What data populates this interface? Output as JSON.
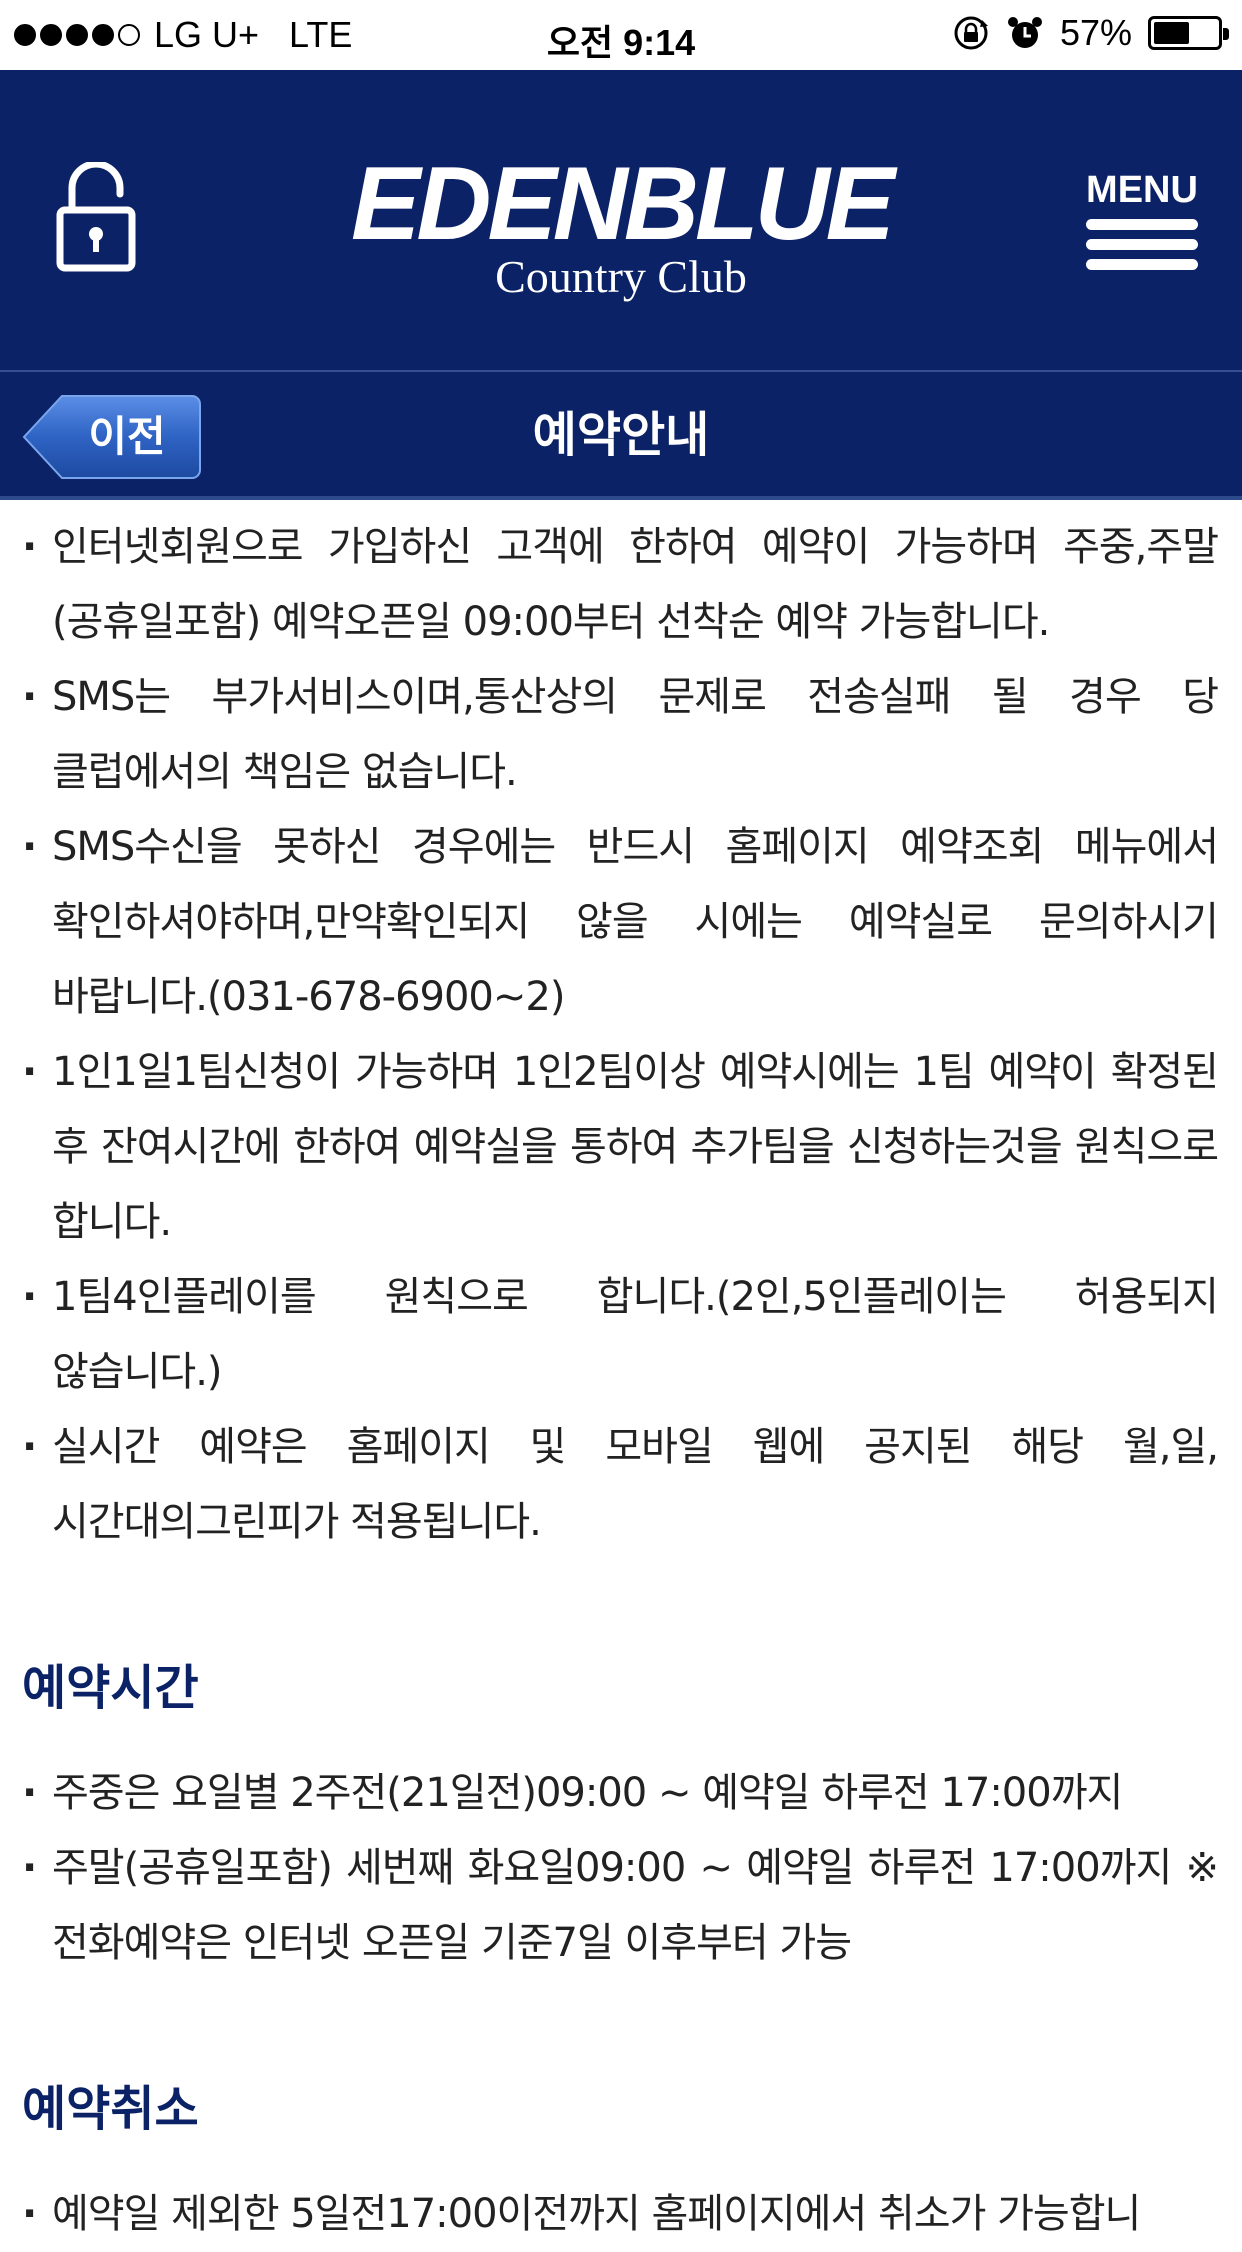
{
  "status_bar": {
    "carrier": "LG U+",
    "network": "LTE",
    "time": "오전 9:14",
    "battery_percent": "57%",
    "battery_level": 0.57,
    "signal_bars": [
      true,
      true,
      true,
      true,
      false
    ]
  },
  "header": {
    "brand_title": "EDENBLUE",
    "brand_subtitle": "Country Club",
    "menu_label": "MENU",
    "lock_icon": "lock-open-icon"
  },
  "title_bar": {
    "back_label": "이전",
    "page_title": "예약안내"
  },
  "intro_items": [
    "인터넷회원으로 가입하신 고객에 한하여 예약이 가능하며 주중,주말(공휴일포함) 예약오픈일 09:00부터 선착순 예약 가능합니다.",
    "SMS는 부가서비스이며,통산상의 문제로 전송실패 될 경우 당 클럽에서의 책임은 없습니다.",
    "SMS수신을 못하신 경우에는 반드시 홈페이지 예약조회 메뉴에서 확인하셔야하며,만약확인되지 않을 시에는 예약실로 문의하시기 바랍니다.(031-678-6900~2)",
    "1인1일1팀신청이 가능하며 1인2팀이상 예약시에는 1팀 예약이 확정된 후 잔여시간에 한하여 예약실을 통하여 추가팀을 신청하는것을 원칙으로 합니다.",
    "1팀4인플레이를 원칙으로 합니다.(2인,5인플레이는 허용되지 않습니다.)",
    "실시간 예약은 홈페이지 및 모바일 웹에 공지된 해당 월,일,시간대의그린피가 적용됩니다."
  ],
  "reservation_time": {
    "heading": "예약시간",
    "items": [
      "주중은 요일별 2주전(21일전)09:00 ~ 예약일 하루전 17:00까지",
      "주말(공휴일포함) 세번째 화요일09:00 ~ 예약일 하루전 17:00까지 ※전화예약은 인터넷 오픈일 기준7일 이후부터 가능"
    ]
  },
  "reservation_cancel": {
    "heading": "예약취소",
    "items": [
      "예약일 제외한 5일전17:00이전까지 홈페이지에서 취소가 가능합니"
    ]
  },
  "colors": {
    "header_bg": "#0b2266",
    "heading_text": "#0b2266",
    "back_button": "#2f63c4"
  }
}
